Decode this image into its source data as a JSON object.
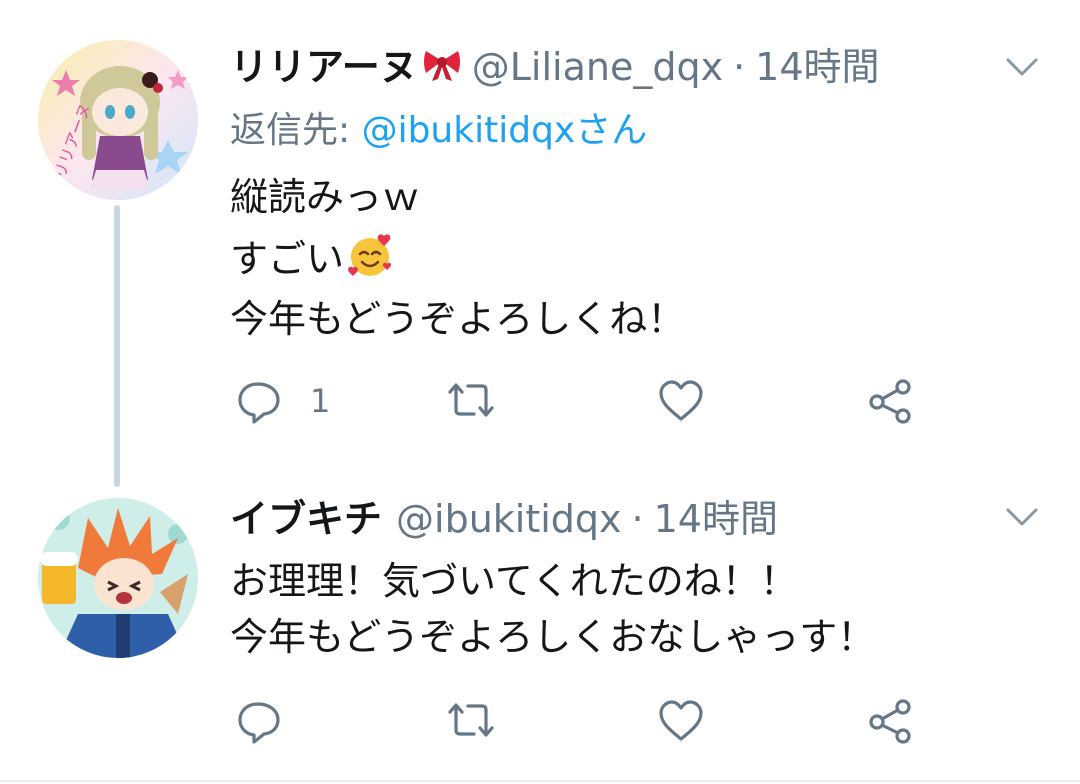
{
  "tweets": [
    {
      "display_name": "リリアーヌ",
      "handle": "@Liliane_dqx",
      "separator": "·",
      "time": "14時間",
      "reply_label": "返信先: ",
      "reply_mention": "@ibukitidqxさん",
      "lines": [
        "縦読みっｗ",
        "すごい",
        "今年もどうぞよろしくね！"
      ],
      "reply_count": "1",
      "avatar_text": "リリアーヌ"
    },
    {
      "display_name": "イブキチ",
      "handle": "@ibukitidqx",
      "separator": "·",
      "time": "14時間",
      "lines": [
        "お理理！気づいてくれたのね！！",
        "今年もどうぞよろしくおなしゃっす！"
      ],
      "reply_count": ""
    }
  ],
  "icons": {
    "name_emoji": "ribbon-icon",
    "text_emoji": "smiling-face-with-hearts-icon",
    "menu": "chevron-down-icon",
    "reply": "reply-icon",
    "retweet": "retweet-icon",
    "like": "heart-icon",
    "share": "share-icon"
  },
  "colors": {
    "name": "#14171a",
    "secondary": "#657786",
    "link": "#1da1f2",
    "thread_line": "#c8d6df",
    "icon": "#657786"
  }
}
